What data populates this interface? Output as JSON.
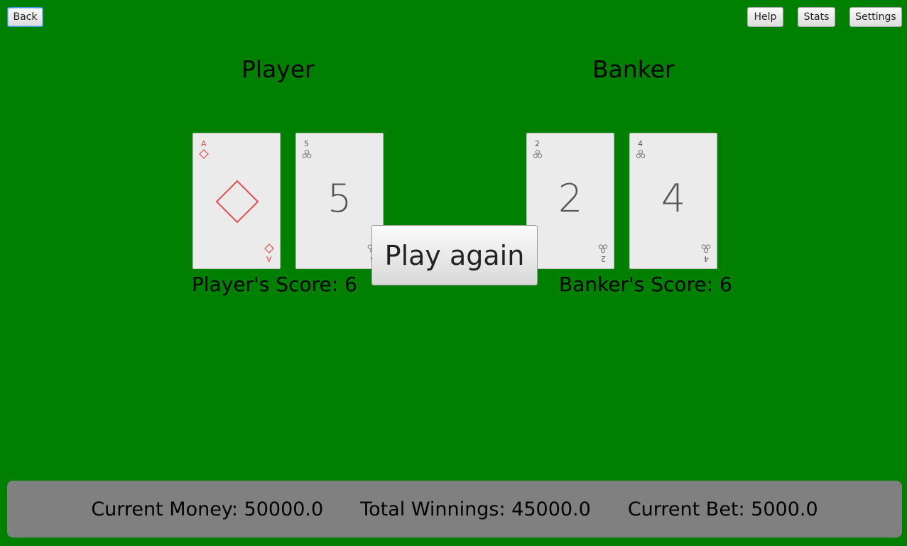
{
  "toolbar": {
    "back_label": "Back",
    "help_label": "Help",
    "stats_label": "Stats",
    "settings_label": "Settings"
  },
  "player": {
    "title": "Player",
    "score_text": "Player's Score: 6",
    "cards": [
      {
        "rank": "A",
        "suit": "diamonds",
        "center": "◇"
      },
      {
        "rank": "5",
        "suit": "clubs",
        "center": "5"
      }
    ]
  },
  "banker": {
    "title": "Banker",
    "score_text": "Banker's Score: 6",
    "cards": [
      {
        "rank": "2",
        "suit": "clubs",
        "center": "2"
      },
      {
        "rank": "4",
        "suit": "clubs",
        "center": "4"
      }
    ]
  },
  "play_again_label": "Play again",
  "status": {
    "current_money": "Current Money: 50000.0",
    "total_winnings": "Total Winnings: 45000.0",
    "current_bet": "Current Bet: 5000.0"
  },
  "colors": {
    "table": "#008000",
    "status_bar": "#808080",
    "diamond": "#e05050",
    "club": "#555555"
  }
}
